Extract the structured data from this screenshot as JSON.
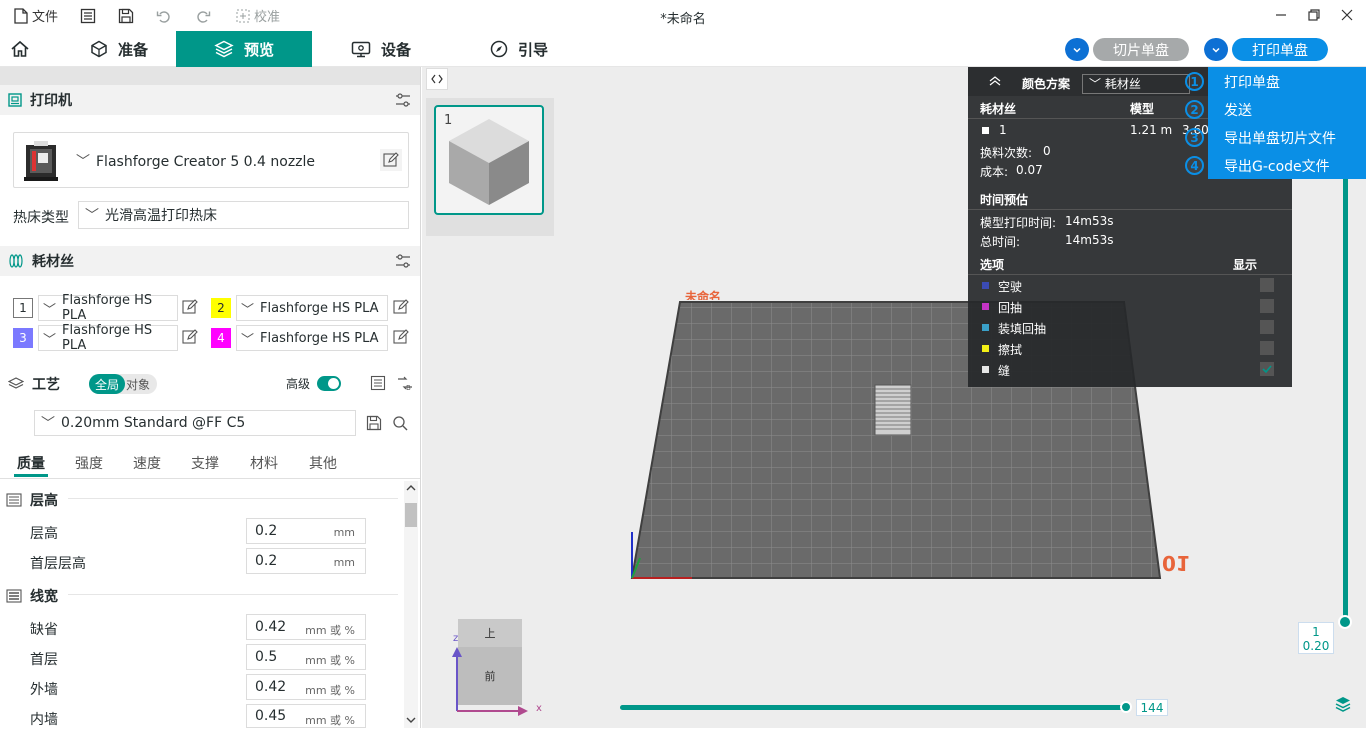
{
  "titlebar": {
    "file_label": "文件",
    "calibrate_label": "校准",
    "doc_title": "*未命名"
  },
  "tabs": [
    {
      "label": "准备"
    },
    {
      "label": "预览"
    },
    {
      "label": "设备"
    },
    {
      "label": "引导"
    }
  ],
  "actions": {
    "slice_label": "切片单盘",
    "print_label": "打印单盘"
  },
  "printer": {
    "section_title": "打印机",
    "name": "Flashforge Creator 5 0.4 nozzle",
    "bed_label": "热床类型",
    "bed_value": "光滑高温打印热床"
  },
  "filament": {
    "section_title": "耗材丝",
    "slots": [
      {
        "num": "1",
        "name": "Flashforge HS PLA",
        "color": "#ffffff",
        "text": "#262e30"
      },
      {
        "num": "2",
        "name": "Flashforge HS PLA",
        "color": "#ffff00",
        "text": "#262e30"
      },
      {
        "num": "3",
        "name": "Flashforge HS PLA",
        "color": "#7b79ff",
        "text": "#ffffff"
      },
      {
        "num": "4",
        "name": "Flashforge HS PLA",
        "color": "#ff00ff",
        "text": "#ffffff"
      }
    ]
  },
  "process": {
    "section_title": "工艺",
    "toggle_global": "全局",
    "toggle_object": "对象",
    "advanced_label": "高级",
    "preset": "0.20mm Standard @FF C5",
    "subtabs": [
      "质量",
      "强度",
      "速度",
      "支撑",
      "材料",
      "其他"
    ],
    "groups": [
      {
        "title": "层高"
      },
      {
        "title": "线宽"
      }
    ],
    "params": [
      {
        "label": "层高",
        "value": "0.2",
        "unit": "mm"
      },
      {
        "label": "首层层高",
        "value": "0.2",
        "unit": "mm"
      },
      {
        "label": "缺省",
        "value": "0.42",
        "unit": "mm 或 %"
      },
      {
        "label": "首层",
        "value": "0.5",
        "unit": "mm 或 %"
      },
      {
        "label": "外墙",
        "value": "0.42",
        "unit": "mm 或 %"
      },
      {
        "label": "内墙",
        "value": "0.45",
        "unit": "mm 或 %"
      }
    ]
  },
  "viewport": {
    "plate_number": "1",
    "plate_name": "未命名",
    "plate_index": "01",
    "layer_top": "1",
    "layer_height": "0.20",
    "slider_value": "144",
    "axis_z": "z",
    "axis_x": "x",
    "cube_top": "上",
    "cube_front": "前"
  },
  "legend": {
    "color_scheme_label": "颜色方案",
    "color_scheme_value": "耗材丝",
    "col_filament": "耗材丝",
    "col_model": "模型",
    "row_num": "1",
    "row_length": "1.21 m",
    "row_extra": "3.60",
    "swap_label": "换料次数:",
    "swap_value": "0",
    "cost_label": "成本:",
    "cost_value": "0.07",
    "time_title": "时间预估",
    "model_time_label": "模型打印时间:",
    "model_time_value": "14m53s",
    "total_time_label": "总时间:",
    "total_time_value": "14m53s",
    "options_label": "选项",
    "display_label": "显示",
    "options": [
      {
        "name": "空驶",
        "color": "#3b4bb3",
        "checked": false
      },
      {
        "name": "回抽",
        "color": "#c534c5",
        "checked": false
      },
      {
        "name": "装填回抽",
        "color": "#3aa0c8",
        "checked": false
      },
      {
        "name": "擦拭",
        "color": "#f2ef16",
        "checked": false
      },
      {
        "name": "缝",
        "color": "#e6e6e6",
        "checked": true
      }
    ]
  },
  "dropdown": {
    "items": [
      {
        "label": "打印单盘",
        "badge": "1"
      },
      {
        "label": "发送",
        "badge": "2"
      },
      {
        "label": "导出单盘切片文件",
        "badge": "3"
      },
      {
        "label": "导出G-code文件",
        "badge": "4"
      }
    ]
  },
  "colors": {
    "accent": "#009789",
    "blue": "#0a8fe6",
    "dropdown_bg": "#0a8fe6"
  }
}
